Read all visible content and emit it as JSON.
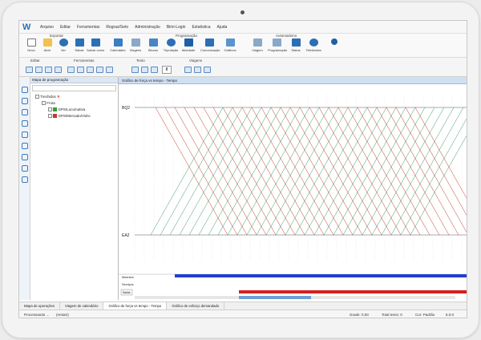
{
  "menu": [
    "Arquivo",
    "Editar",
    "Ferramentas",
    "Regras/Seto",
    "Administração",
    "Bimi-Login",
    "Estatística",
    "Ajuda"
  ],
  "ribbon": {
    "groups": [
      "Exportar",
      "Programação",
      "Automatismo"
    ],
    "buttons": [
      "Novo",
      "Abrir",
      "Ver",
      "Salvar",
      "Salvar como",
      "Calendário",
      "Viagens",
      "Blocos",
      "Tripulação",
      "Atividade",
      "Comunicação",
      "Gráficos",
      "Viagem",
      "Programação",
      "Status",
      "Telefonista"
    ]
  },
  "toolbar2": {
    "groups": [
      "Editar",
      "Ferramentas",
      "Texto",
      "Viagens"
    ],
    "font_size": "8"
  },
  "panel": {
    "title": "Mapa de programação",
    "tree": [
      {
        "label": "Trechidos",
        "indent": 0
      },
      {
        "label": "Frota",
        "indent": 1
      },
      {
        "label": "GPS/Locomotiva",
        "indent": 2
      },
      {
        "label": "GPS/Mercado/Vidro",
        "indent": 2
      }
    ]
  },
  "chart": {
    "tab_title": "Gráfico de força vs tempo - Tempo",
    "station_top": "BQ2",
    "station_bottom": "EA2",
    "row_labels": [
      "Itinerário",
      "Serviços",
      "Saída"
    ]
  },
  "chart_data": {
    "type": "line",
    "title": "",
    "series": [
      {
        "name": "",
        "color": "#3a9a6a",
        "values": []
      },
      {
        "name": "",
        "color": "#c0392b",
        "values": []
      }
    ]
  },
  "bottom_tabs": [
    "Mapa de operações",
    "Viagem de calendário",
    "Gráfico de força vs tempo - Tempo",
    "Gráfico de esforço demandado"
  ],
  "status": {
    "left": "Processando ...",
    "left2": "(restart)",
    "grade": "Grade: 0,00",
    "trains": "Total trens: 0",
    "color": "Cor: Padrão",
    "version": "5.0.0"
  }
}
